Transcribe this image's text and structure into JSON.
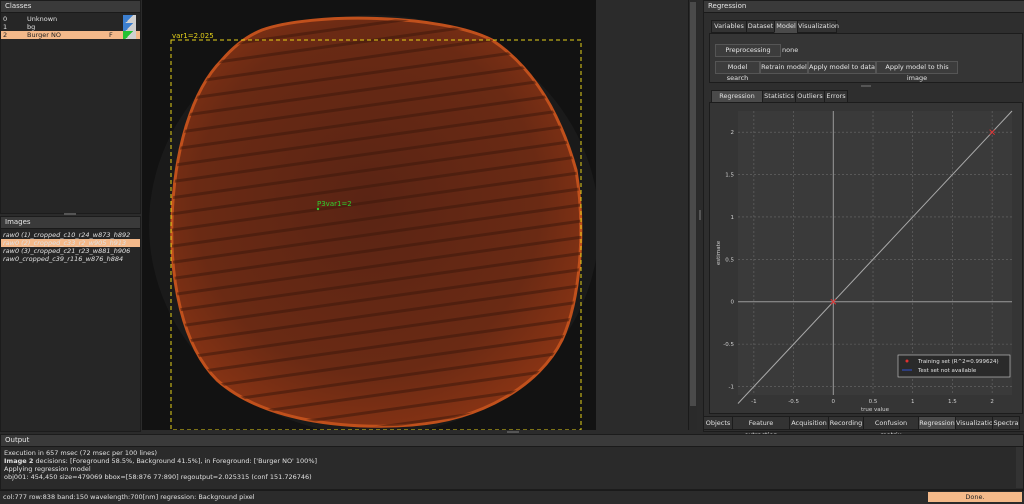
{
  "classes": {
    "title": "Classes",
    "rows": [
      {
        "idx": "0",
        "name": "Unknown",
        "flag": "",
        "color": "#3c7fd0"
      },
      {
        "idx": "1",
        "name": "bg",
        "flag": "",
        "color": "#3c7fd0"
      },
      {
        "idx": "2",
        "name": "Burger NO",
        "flag": "F",
        "color": "#22c232"
      }
    ]
  },
  "images": {
    "title": "Images",
    "rows": [
      "raw0 (1)_cropped_c10_r24_w873_h892",
      "raw0 (2)_cropped_c33_r2_w905_h913",
      "raw0 (3)_cropped_c21_r23_w881_h906",
      "raw0_cropped_c39_r116_w876_h884"
    ],
    "selected_index": 1
  },
  "canvas": {
    "roi_label": "var1=2.025",
    "point_label": "P3var1=2"
  },
  "regression": {
    "title": "Regression",
    "top_tabs": [
      "Variables",
      "Dataset",
      "Model",
      "Visualization"
    ],
    "top_active": 2,
    "preprocessing_label": "Preprocessing",
    "preprocessing_value": "none",
    "buttons": [
      "Model search",
      "Retrain model",
      "Apply model to data",
      "Apply model to this image"
    ],
    "sub_tabs": [
      "Regression plot",
      "Statistics",
      "Outliers",
      "Errors"
    ],
    "sub_active": 0
  },
  "bottom_tabs": {
    "items": [
      "Objects",
      "Feature extraction",
      "Acquisition",
      "Recording",
      "Confusion matrix",
      "Regression",
      "Visualization",
      "Spectra"
    ],
    "active": 5
  },
  "chart_data": {
    "type": "scatter",
    "xlabel": "true value",
    "ylabel": "estimate",
    "xlim": [
      -1.2,
      2.25
    ],
    "ylim": [
      -1.1,
      2.25
    ],
    "x_ticks": [
      -1,
      -0.5,
      0,
      0.5,
      1,
      1.5,
      2
    ],
    "x_tick_labels": [
      "-1",
      "-0.5",
      "0",
      "0.5",
      "1",
      "1.5",
      "2"
    ],
    "y_ticks": [
      -1,
      -0.5,
      0,
      0.5,
      1,
      1.5,
      2
    ],
    "y_tick_labels": [
      "-1",
      "-0.5",
      "0",
      "0.5",
      "1",
      "1.5",
      "2"
    ],
    "grid": true,
    "series": [
      {
        "name": "Training set (R^2=0.999624)",
        "points": [
          [
            0,
            0
          ],
          [
            2,
            2
          ]
        ],
        "color": "#e03030"
      }
    ],
    "fit_line": {
      "from": [
        -1.2,
        -1.2
      ],
      "to": [
        2.25,
        2.25
      ],
      "color": "#aaaaaa"
    },
    "legend": {
      "position": "bottom-right",
      "items": [
        {
          "label": "Training set (R^2=0.999624)",
          "color": "#e03030",
          "marker": "point"
        },
        {
          "label": "Test set not available",
          "color": "#3050d0",
          "marker": "line"
        }
      ]
    }
  },
  "output": {
    "title": "Output",
    "lines": [
      "Execution in 657 msec (72 msec per 100 lines)",
      "Image 2 decisions: [Foreground 58.5%, Background 41.5%], in Foreground: ['Burger NO' 100%]",
      "Applying regression model",
      "obj001: 454,450 size=479069 bbox=[58:876 77:890] regoutput=2.025315 (conf 151.726746)"
    ],
    "bold_prefix": "Image 2"
  },
  "status": {
    "text": "col:777 row:838 band:150 wavelength:700[nm] regression: Background pixel",
    "done": "Done."
  }
}
